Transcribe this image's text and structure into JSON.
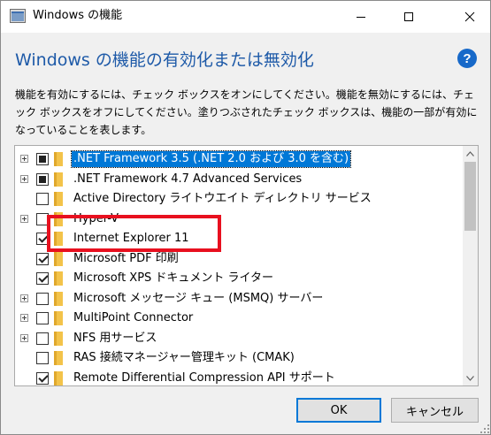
{
  "window": {
    "title": "Windows の機能",
    "heading": "Windows の機能の有効化または無効化",
    "description": "機能を有効にするには、チェック ボックスをオンにしてください。機能を無効にするには、チェック ボックスをオフにしてください。塗りつぶされたチェック ボックスは、機能の一部が有効になっていることを表します。",
    "help_symbol": "?"
  },
  "features": [
    {
      "label": ".NET Framework 3.5 (.NET 2.0 および 3.0 を含む)",
      "state": "partial",
      "expandable": true,
      "selected": true
    },
    {
      "label": ".NET Framework 4.7 Advanced Services",
      "state": "partial",
      "expandable": true,
      "selected": false
    },
    {
      "label": "Active Directory ライトウエイト ディレクトリ サービス",
      "state": "unchecked",
      "expandable": false,
      "selected": false
    },
    {
      "label": "Hyper-V",
      "state": "unchecked",
      "expandable": true,
      "selected": false
    },
    {
      "label": "Internet Explorer 11",
      "state": "checked",
      "expandable": false,
      "selected": false
    },
    {
      "label": "Microsoft PDF 印刷",
      "state": "checked",
      "expandable": false,
      "selected": false
    },
    {
      "label": "Microsoft XPS ドキュメント ライター",
      "state": "checked",
      "expandable": false,
      "selected": false
    },
    {
      "label": "Microsoft メッセージ キュー (MSMQ) サーバー",
      "state": "unchecked",
      "expandable": true,
      "selected": false
    },
    {
      "label": "MultiPoint Connector",
      "state": "unchecked",
      "expandable": true,
      "selected": false
    },
    {
      "label": "NFS 用サービス",
      "state": "unchecked",
      "expandable": true,
      "selected": false
    },
    {
      "label": "RAS 接続マネージャー管理キット (CMAK)",
      "state": "unchecked",
      "expandable": false,
      "selected": false
    },
    {
      "label": "Remote Differential Compression API サポート",
      "state": "checked",
      "expandable": false,
      "selected": false
    }
  ],
  "buttons": {
    "ok": "OK",
    "cancel": "キャンセル"
  },
  "colors": {
    "accent": "#0078d7",
    "heading": "#1e5aa8",
    "highlight": "#e8101f",
    "folder": "#f3c34a"
  }
}
